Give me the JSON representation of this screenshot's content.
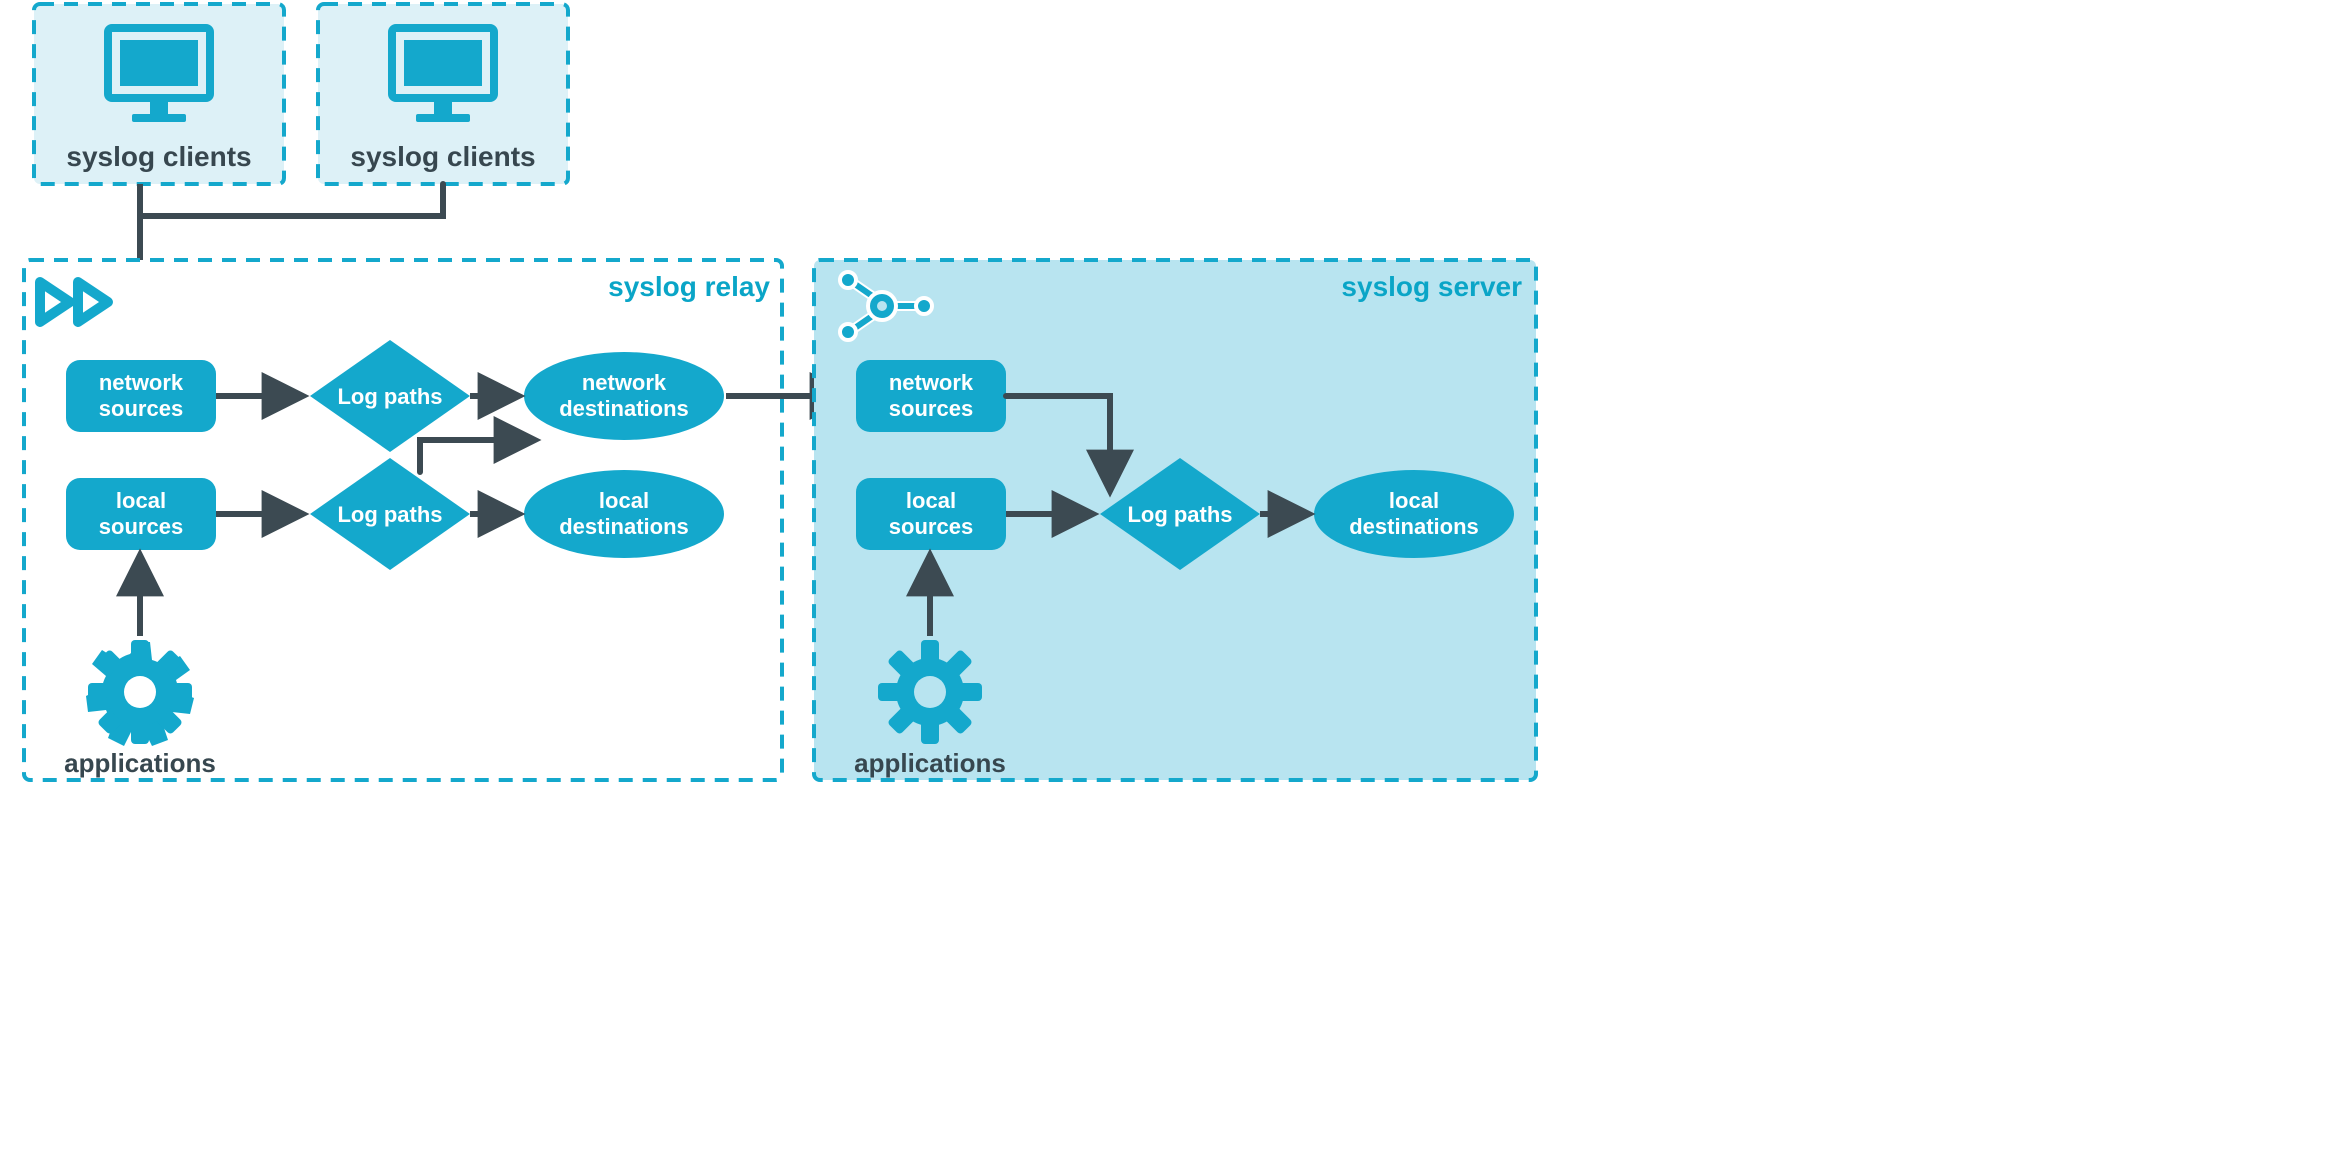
{
  "clients": {
    "left_label": "syslog clients",
    "right_label": "syslog clients"
  },
  "relay": {
    "title": "syslog relay",
    "network_sources": "network\nsources",
    "local_sources": "local\nsources",
    "log_paths_top": "Log paths",
    "log_paths_bottom": "Log paths",
    "network_destinations": "network\ndestinations",
    "local_destinations": "local\ndestinations",
    "applications": "applications"
  },
  "server": {
    "title": "syslog server",
    "network_sources": "network\nsources",
    "local_sources": "local\nsources",
    "log_paths": "Log paths",
    "local_destinations": "local\ndestinations",
    "applications": "applications"
  },
  "colors": {
    "teal": "#14a8cc",
    "teal_light": "#cdeef6",
    "panel_light": "#b8e4f0",
    "arrow": "#3c4a52",
    "label": "#37474f"
  }
}
